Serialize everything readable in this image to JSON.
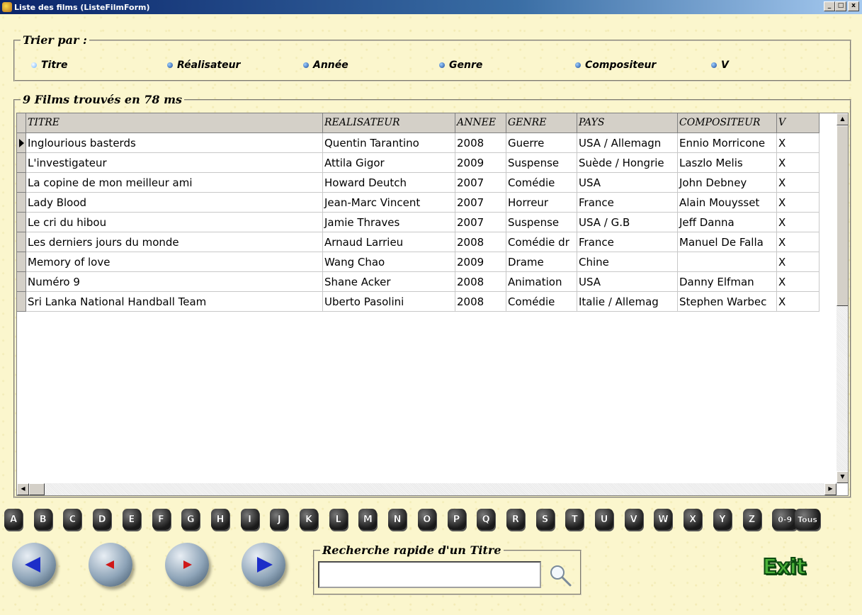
{
  "window": {
    "title": "Liste des films (ListeFilmForm)",
    "min_label": "_",
    "max_label": "□",
    "close_label": "x"
  },
  "sort": {
    "legend": "Trier par :",
    "options": [
      {
        "label": "Titre",
        "checked": true
      },
      {
        "label": "Réalisateur",
        "checked": false
      },
      {
        "label": "Année",
        "checked": false
      },
      {
        "label": "Genre",
        "checked": false
      },
      {
        "label": "Compositeur",
        "checked": false
      },
      {
        "label": "V",
        "checked": false
      }
    ]
  },
  "results": {
    "legend": "9 Films trouvés en  78 ms"
  },
  "grid": {
    "columns": [
      "TITRE",
      "REALISATEUR",
      "ANNEE",
      "GENRE",
      "PAYS",
      "COMPOSITEUR",
      "V"
    ],
    "rows": [
      [
        "Inglourious basterds",
        "Quentin Tarantino",
        "2008",
        "Guerre",
        "USA / Allemagn",
        "Ennio Morricone",
        "X"
      ],
      [
        "L'investigateur",
        "Attila Gigor",
        "2009",
        "Suspense",
        "Suède / Hongrie",
        "Laszlo Melis",
        "X"
      ],
      [
        "La copine de mon meilleur ami",
        "Howard Deutch",
        "2007",
        "Comédie",
        "USA",
        "John Debney",
        "X"
      ],
      [
        "Lady Blood",
        "Jean-Marc Vincent",
        "2007",
        "Horreur",
        "France",
        "Alain Mouysset",
        "X"
      ],
      [
        "Le cri du hibou",
        "Jamie Thraves",
        "2007",
        "Suspense",
        "USA / G.B",
        "Jeff Danna",
        "X"
      ],
      [
        "Les derniers jours du monde",
        "Arnaud Larrieu",
        "2008",
        "Comédie dr",
        "France",
        "Manuel De Falla",
        "X"
      ],
      [
        "Memory of love",
        "Wang Chao",
        "2009",
        "Drame",
        "Chine",
        "",
        "X"
      ],
      [
        "Numéro 9",
        "Shane Acker",
        "2008",
        "Animation",
        "USA",
        "Danny Elfman",
        "X"
      ],
      [
        "Sri Lanka National Handball Team",
        "Uberto Pasolini",
        "2008",
        "Comédie",
        "Italie / Allemag",
        "Stephen Warbec",
        "X"
      ]
    ]
  },
  "letters": [
    "A",
    "B",
    "C",
    "D",
    "E",
    "F",
    "G",
    "H",
    "I",
    "J",
    "K",
    "L",
    "M",
    "N",
    "O",
    "P",
    "Q",
    "R",
    "S",
    "T",
    "U",
    "V",
    "W",
    "X",
    "Y",
    "Z",
    "0-9",
    "Tous"
  ],
  "quick_search": {
    "legend": "Recherche rapide d'un Titre",
    "value": ""
  },
  "exit": {
    "label": "Exit"
  },
  "colors": {
    "background": "#fbf6cd",
    "titlebar": "#0a246a",
    "exit_green": "#4bb23a"
  }
}
